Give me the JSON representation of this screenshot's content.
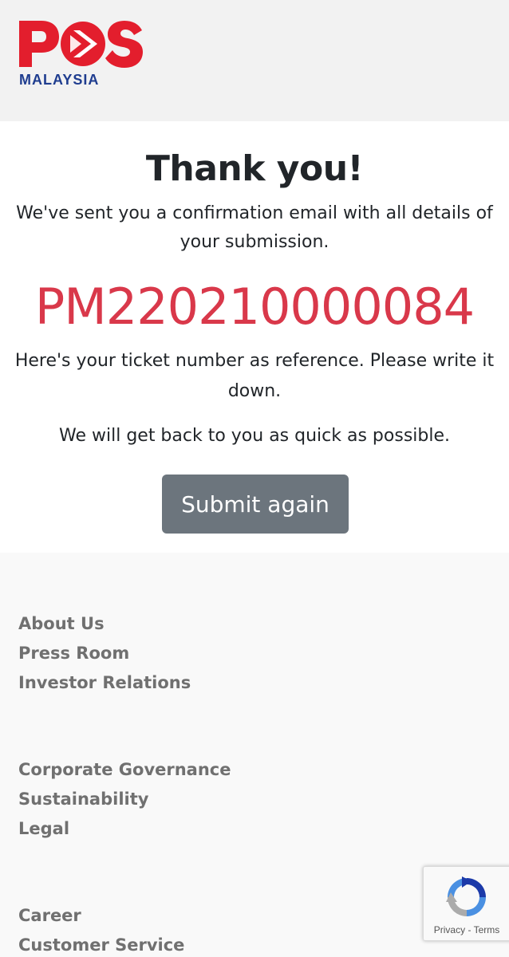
{
  "header": {
    "logo_word": "POS",
    "logo_sub": "MALAYSIA"
  },
  "main": {
    "title": "Thank you!",
    "sent_text": "We've sent you a confirmation email with all details of your submission.",
    "ticket_number": "PM220210000084",
    "reference_text": "Here's your ticket number as reference. Please write it down.",
    "back_text": "We will get back to you as quick as possible.",
    "submit_again_label": "Submit again"
  },
  "footer": {
    "group1": [
      "About Us",
      "Press Room",
      "Investor Relations"
    ],
    "group2": [
      "Corporate Governance",
      "Sustainability",
      "Legal"
    ],
    "group3": [
      "Career",
      "Customer Service"
    ]
  },
  "recaptcha": {
    "privacy": "Privacy",
    "separator": " - ",
    "terms": "Terms"
  },
  "colors": {
    "brand_red": "#e31e2d",
    "brand_blue": "#1f3d8f",
    "ticket_red": "#d9384a",
    "button_gray": "#6c757d",
    "link_gray": "#707070"
  }
}
